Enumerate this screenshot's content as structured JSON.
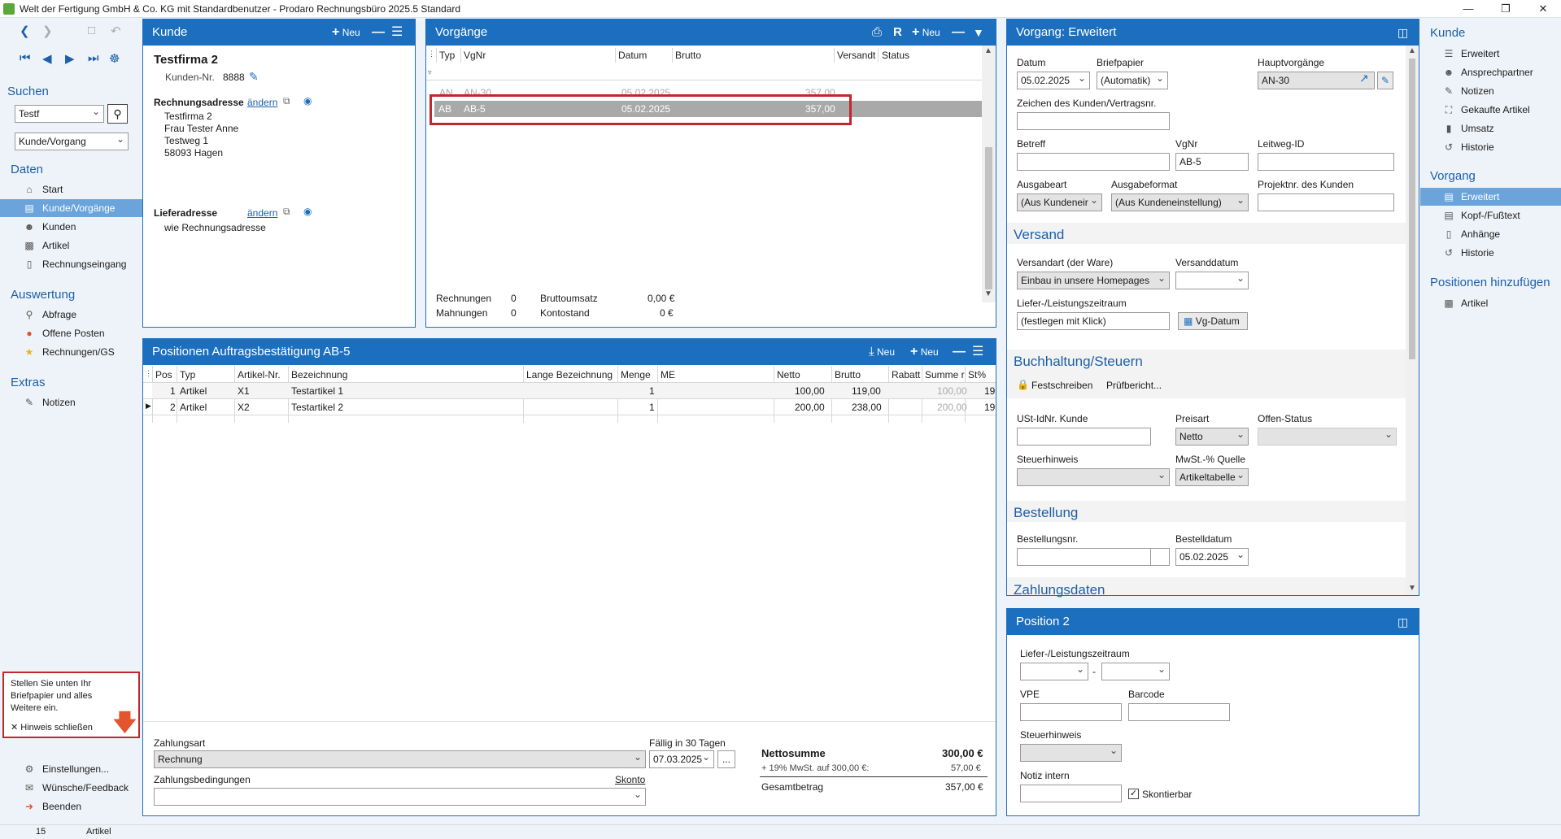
{
  "window": {
    "title": "Welt der Fertigung GmbH & Co. KG mit Standardbenutzer  -  Prodaro Rechnungsbüro 2025.5 Standard"
  },
  "leftnav": {
    "search_title": "Suchen",
    "search_value": "Testf",
    "scope_value": "Kunde/Vorgang",
    "daten_title": "Daten",
    "daten_items": [
      "Start",
      "Kunde/Vorgänge",
      "Kunden",
      "Artikel",
      "Rechnungseingang"
    ],
    "auswertung_title": "Auswertung",
    "auswertung_items": [
      "Abfrage",
      "Offene Posten",
      "Rechnungen/GS"
    ],
    "extras_title": "Extras",
    "extras_items": [
      "Notizen"
    ],
    "hint_text": "Stellen Sie unten Ihr Briefpapier und alles Weitere ein.",
    "hint_close": "Hinweis schließen",
    "bottom_items": [
      "Einstellungen...",
      "Wünsche/Feedback",
      "Beenden"
    ]
  },
  "kunde": {
    "title": "Kunde",
    "new_label": "Neu",
    "name": "Testfirma 2",
    "kundennr_label": "Kunden-Nr.",
    "kundennr": "8888",
    "rechnungsadresse_label": "Rechnungsadresse",
    "aendern": "ändern",
    "address": [
      "Testfirma 2",
      "Frau Tester Anne",
      "Testweg 1",
      "58093 Hagen"
    ],
    "lieferadresse_label": "Lieferadresse",
    "liefer_text": "wie Rechnungsadresse"
  },
  "vorgaenge": {
    "title": "Vorgänge",
    "new_label": "Neu",
    "r_label": "R",
    "columns": [
      "Typ",
      "VgNr",
      "Datum",
      "Brutto",
      "Versandt",
      "Status"
    ],
    "rows": [
      {
        "typ": "AN",
        "vgnr": "AN-30",
        "datum": "05.02.2025",
        "brutto": "357,00"
      },
      {
        "typ": "AB",
        "vgnr": "AB-5",
        "datum": "05.02.2025",
        "brutto": "357,00"
      }
    ],
    "rechnungen_label": "Rechnungen",
    "rechnungen_val": "0",
    "mahnungen_label": "Mahnungen",
    "mahnungen_val": "0",
    "brutto_label": "Bruttoumsatz",
    "brutto_val": "0,00 €",
    "konto_label": "Kontostand",
    "konto_val": "0 €"
  },
  "positionen": {
    "title": "Positionen Auftragsbestätigung AB-5",
    "new1": "Neu",
    "new2": "Neu",
    "columns": [
      "Pos",
      "Typ",
      "Artikel-Nr.",
      "Bezeichnung",
      "Lange Bezeichnung",
      "Menge",
      "ME",
      "Netto",
      "Brutto",
      "Rabatt",
      "Summe r",
      "St%"
    ],
    "rows": [
      {
        "pos": "1",
        "typ": "Artikel",
        "nr": "X1",
        "bez": "Testartikel 1",
        "menge": "1",
        "netto": "100,00",
        "brutto": "119,00",
        "summe": "100,00",
        "st": "19"
      },
      {
        "pos": "2",
        "typ": "Artikel",
        "nr": "X2",
        "bez": "Testartikel 2",
        "menge": "1",
        "netto": "200,00",
        "brutto": "238,00",
        "summe": "200,00",
        "st": "19"
      }
    ],
    "zahlungsart_label": "Zahlungsart",
    "zahlungsart": "Rechnung",
    "faellig_label": "Fällig in 30 Tagen",
    "faellig": "07.03.2025",
    "ellipsis": "...",
    "zahlbed_label": "Zahlungsbedingungen",
    "skonto": "Skonto",
    "netto_label": "Nettosumme",
    "netto_val": "300,00  €",
    "mwst_label": "+ 19% MwSt. auf 300,00 €:",
    "mwst_val": "57,00  €",
    "gesamt_label": "Gesamtbetrag",
    "gesamt_val": "357,00  €"
  },
  "erweitert": {
    "title": "Vorgang: Erweitert",
    "datum_label": "Datum",
    "datum": "05.02.2025",
    "briefpapier_label": "Briefpapier",
    "briefpapier": "(Automatik)",
    "haupt_label": "Hauptvorgänge",
    "haupt": "AN-30",
    "zeichen_label": "Zeichen des Kunden/Vertragsnr.",
    "betreff_label": "Betreff",
    "vgnr_label": "VgNr",
    "vgnr": "AB-5",
    "leitweg_label": "Leitweg-ID",
    "ausgabeart_label": "Ausgabeart",
    "ausgabeart": "(Aus Kundeneir",
    "ausgabeformat_label": "Ausgabeformat",
    "ausgabeformat": "(Aus Kundeneinstellung)",
    "projekt_label": "Projektnr. des Kunden",
    "versand_title": "Versand",
    "versandart_label": "Versandart (der Ware)",
    "versandart": "Einbau in unsere Homepages",
    "versanddatum_label": "Versanddatum",
    "liefer_label": "Liefer-/Leistungszeitraum",
    "liefer": "(festlegen mit Klick)",
    "vgdatum_btn": "Vg-Datum",
    "buch_title": "Buchhaltung/Steuern",
    "festschreiben": "Festschreiben",
    "pruefbericht": "Prüfbericht...",
    "ust_label": "USt-IdNr. Kunde",
    "preisart_label": "Preisart",
    "preisart": "Netto",
    "offen_label": "Offen-Status",
    "steuerhinweis_label": "Steuerhinweis",
    "mwst_quelle_label": "MwSt.-% Quelle",
    "mwst_quelle": "Artikeltabelle",
    "bestellung_title": "Bestellung",
    "bestellnr_label": "Bestellungsnr.",
    "bestelldatum_label": "Bestelldatum",
    "bestelldatum": "05.02.2025",
    "zahlung_title": "Zahlungsdaten"
  },
  "position2": {
    "title": "Position 2",
    "liefer_label": "Liefer-/Leistungszeitraum",
    "dash": "-",
    "vpe_label": "VPE",
    "barcode_label": "Barcode",
    "steuer_label": "Steuerhinweis",
    "notiz_label": "Notiz intern",
    "skontierbar": "Skontierbar"
  },
  "rightnav": {
    "kunde_title": "Kunde",
    "kunde_items": [
      "Erweitert",
      "Ansprechpartner",
      "Notizen",
      "Gekaufte Artikel",
      "Umsatz",
      "Historie"
    ],
    "vorgang_title": "Vorgang",
    "vorgang_items": [
      "Erweitert",
      "Kopf-/Fußtext",
      "Anhänge",
      "Historie"
    ],
    "positionen_title": "Positionen hinzufügen",
    "positionen_items": [
      "Artikel"
    ]
  },
  "statusbar": {
    "count": "15",
    "label": "Artikel"
  }
}
